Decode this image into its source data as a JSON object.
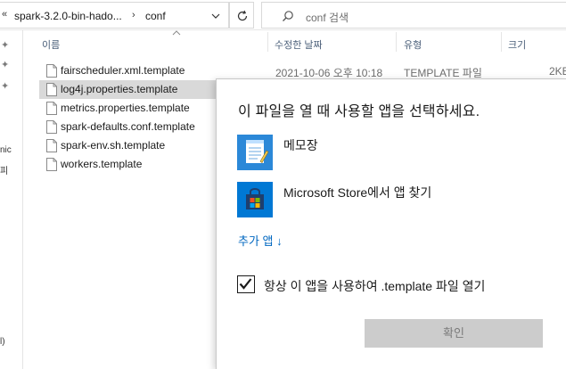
{
  "address_bar": {
    "overflow_chevron": "«",
    "crumbs": [
      "spark-3.2.0-bin-hado...",
      "conf"
    ],
    "separator": "›"
  },
  "search": {
    "placeholder": "conf 검색"
  },
  "nav_strip": {
    "fragments": [
      "nic",
      "피",
      "l)"
    ]
  },
  "columns": {
    "name": "이름",
    "modified": "수정한 날짜",
    "type": "유형",
    "size": "크기"
  },
  "files": [
    {
      "name": "fairscheduler.xml.template",
      "selected": false
    },
    {
      "name": "log4j.properties.template",
      "selected": true
    },
    {
      "name": "metrics.properties.template",
      "selected": false
    },
    {
      "name": "spark-defaults.conf.template",
      "selected": false
    },
    {
      "name": "spark-env.sh.template",
      "selected": false
    },
    {
      "name": "workers.template",
      "selected": false
    }
  ],
  "first_row_meta": {
    "modified": "2021-10-06 오후 10:18",
    "type": "TEMPLATE 파일",
    "size": "2KE"
  },
  "dialog": {
    "title": "이 파일을 열 때 사용할 앱을 선택하세요.",
    "apps": [
      {
        "label": "메모장",
        "icon": "notepad-icon"
      },
      {
        "label": "Microsoft Store에서 앱 찾기",
        "icon": "store-icon"
      }
    ],
    "more_apps": "추가 앱 ↓",
    "always_use": {
      "label": "항상 이 앱을 사용하여 .template 파일 열기",
      "checked": true
    },
    "ok_button": "확인"
  },
  "colors": {
    "accent": "#0067c0",
    "selection": "#d9d9d9",
    "button_disabled": "#cccccc"
  }
}
